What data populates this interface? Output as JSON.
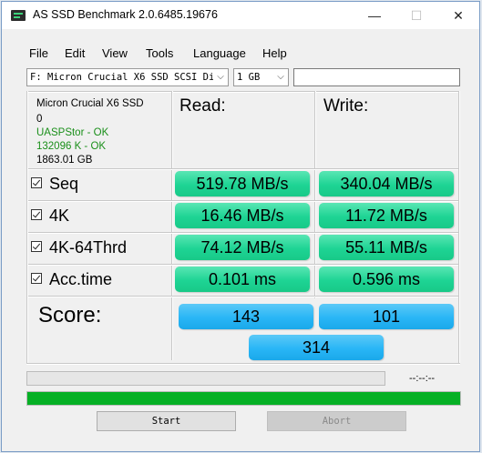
{
  "window": {
    "title": "AS SSD Benchmark 2.0.6485.19676",
    "minimize_glyph": "—",
    "maximize_glyph": "☐",
    "close_glyph": "✕"
  },
  "menu": [
    "File",
    "Edit",
    "View",
    "Tools",
    "Language",
    "Help"
  ],
  "toolbar": {
    "drive_select": "F: Micron Crucial X6 SSD SCSI Dis",
    "size_select": "1 GB",
    "dropdown_glyph": "⌵",
    "text_field": ""
  },
  "drive_info": {
    "name": "Micron Crucial X6 SSD",
    "id": "0",
    "driver": "UASPStor - OK",
    "alignment": "132096 K - OK",
    "capacity": "1863.01 GB",
    "ok_color": "#1a8f1a"
  },
  "columns": {
    "read": "Read:",
    "write": "Write:"
  },
  "tests": [
    {
      "label": "Seq",
      "checked": true,
      "read": "519.78 MB/s",
      "write": "340.04 MB/s"
    },
    {
      "label": "4K",
      "checked": true,
      "read": "16.46 MB/s",
      "write": "11.72 MB/s"
    },
    {
      "label": "4K-64Thrd",
      "checked": true,
      "read": "74.12 MB/s",
      "write": "55.11 MB/s"
    },
    {
      "label": "Acc.time",
      "checked": true,
      "read": "0.101 ms",
      "write": "0.596 ms"
    }
  ],
  "score": {
    "label": "Score:",
    "read": "143",
    "write": "101",
    "total": "314"
  },
  "status": {
    "elapsed": "--:--:--",
    "progress_fraction": 1.0,
    "progress_color": "#06b025"
  },
  "buttons": {
    "start": "Start",
    "abort": "Abort"
  },
  "colors": {
    "result_green": "#1ed494",
    "score_blue": "#29b6f6"
  }
}
